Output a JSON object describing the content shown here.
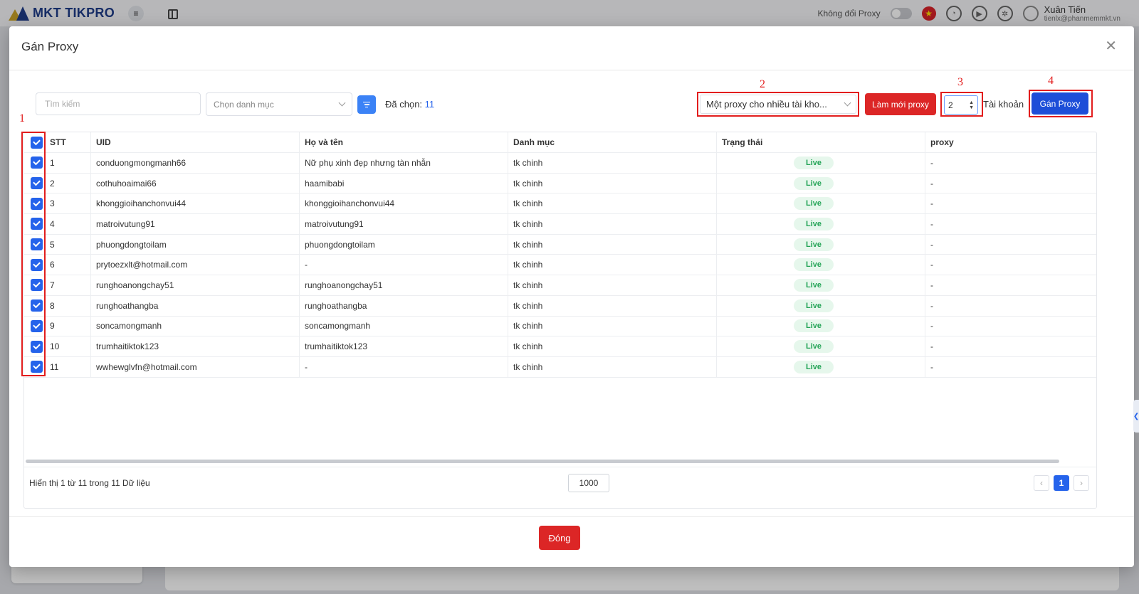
{
  "app": {
    "logo_text": "MKT TIKPRO",
    "proxy_toggle_label": "Không đổi Proxy",
    "user_name": "Xuân Tiến",
    "user_email": "tienlx@phanmemmkt.vn"
  },
  "modal": {
    "title": "Gán Proxy",
    "search_placeholder": "Tìm kiếm",
    "category_placeholder": "Chọn danh mục",
    "selected_label": "Đã chọn:",
    "selected_count": "11",
    "mode_select_value": "Một proxy cho nhiều tài kho...",
    "refresh_button": "Làm mới proxy",
    "account_count": "2",
    "account_label": "Tài khoản",
    "assign_button": "Gán Proxy",
    "close_button": "Đóng"
  },
  "annotations": [
    "1",
    "2",
    "3",
    "4"
  ],
  "table": {
    "columns": [
      "STT",
      "UID",
      "Họ và tên",
      "Danh mục",
      "Trạng thái",
      "proxy"
    ],
    "rows": [
      {
        "stt": "1",
        "uid": "conduongmongmanh66",
        "name": "Nữ phụ xinh đẹp nhưng tàn nhẫn",
        "category": "tk chinh",
        "status": "Live",
        "proxy": "-"
      },
      {
        "stt": "2",
        "uid": "cothuhoaimai66",
        "name": "haamibabi",
        "category": "tk chinh",
        "status": "Live",
        "proxy": "-"
      },
      {
        "stt": "3",
        "uid": "khonggioihanchonvui44",
        "name": "khonggioihanchonvui44",
        "category": "tk chinh",
        "status": "Live",
        "proxy": "-"
      },
      {
        "stt": "4",
        "uid": "matroivutung91",
        "name": "matroivutung91",
        "category": "tk chinh",
        "status": "Live",
        "proxy": "-"
      },
      {
        "stt": "5",
        "uid": "phuongdongtoilam",
        "name": "phuongdongtoilam",
        "category": "tk chinh",
        "status": "Live",
        "proxy": "-"
      },
      {
        "stt": "6",
        "uid": "prytoezxlt@hotmail.com",
        "name": "-",
        "category": "tk chinh",
        "status": "Live",
        "proxy": "-"
      },
      {
        "stt": "7",
        "uid": "runghoanongchay51",
        "name": "runghoanongchay51",
        "category": "tk chinh",
        "status": "Live",
        "proxy": "-"
      },
      {
        "stt": "8",
        "uid": "runghoathangba",
        "name": "runghoathangba",
        "category": "tk chinh",
        "status": "Live",
        "proxy": "-"
      },
      {
        "stt": "9",
        "uid": "soncamongmanh",
        "name": "soncamongmanh",
        "category": "tk chinh",
        "status": "Live",
        "proxy": "-"
      },
      {
        "stt": "10",
        "uid": "trumhaitiktok123",
        "name": "trumhaitiktok123",
        "category": "tk chinh",
        "status": "Live",
        "proxy": "-"
      },
      {
        "stt": "11",
        "uid": "wwhewglvfn@hotmail.com",
        "name": "-",
        "category": "tk chinh",
        "status": "Live",
        "proxy": "-"
      }
    ],
    "footer_info": "Hiển thị 1 từ 11 trong 11 Dữ liệu",
    "page_size": "1000",
    "current_page": "1"
  },
  "colors": {
    "primary": "#2563eb",
    "danger": "#dc2626",
    "annotation": "#e21d1d",
    "live_bg": "#e6f7ec",
    "live_text": "#22a355"
  }
}
